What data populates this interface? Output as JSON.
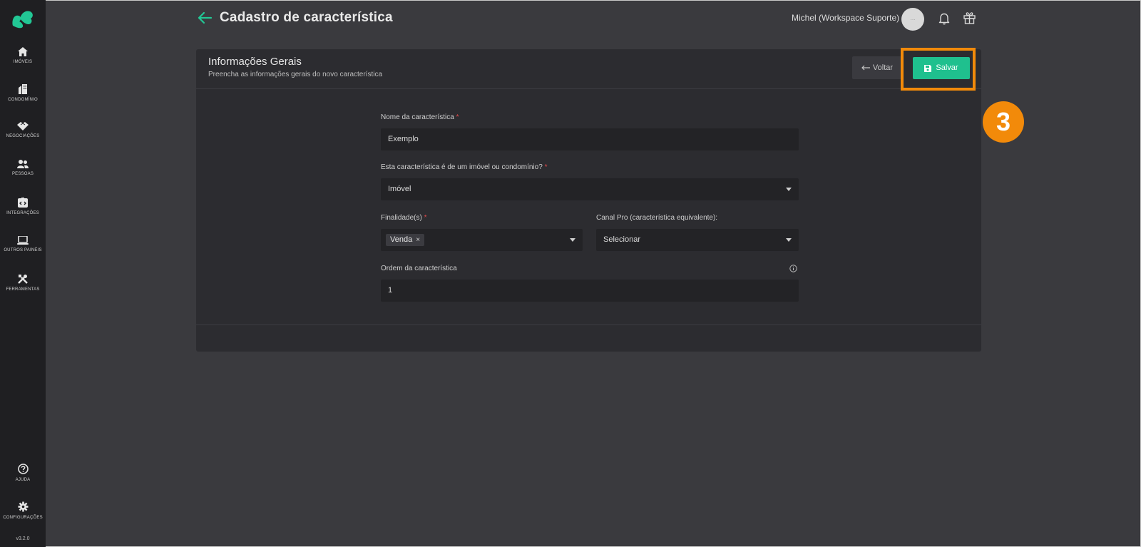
{
  "header": {
    "title": "Cadastro de característica",
    "user_name": "Michel (Workspace Suporte)",
    "avatar_text": "..."
  },
  "sidebar": {
    "items": [
      {
        "label": "IMÓVEIS",
        "icon": "home-icon"
      },
      {
        "label": "CONDOMÍNIO",
        "icon": "building-icon"
      },
      {
        "label": "NEGOCIAÇÕES",
        "icon": "handshake-icon"
      },
      {
        "label": "PESSOAS",
        "icon": "users-icon"
      },
      {
        "label": "INTEGRAÇÕES",
        "icon": "integration-icon"
      },
      {
        "label": "OUTROS PAINÉIS",
        "icon": "laptop-icon"
      },
      {
        "label": "FERRAMENTAS",
        "icon": "tools-icon"
      }
    ],
    "bottom_items": [
      {
        "label": "AJUDA",
        "icon": "help-icon"
      },
      {
        "label": "CONFIGURAÇÕES",
        "icon": "gear-icon"
      }
    ],
    "version": "v3.2.0"
  },
  "card": {
    "title": "Informações Gerais",
    "subtitle": "Preencha as informações gerais do novo característica",
    "back_label": "Voltar",
    "save_label": "Salvar"
  },
  "form": {
    "name": {
      "label": "Nome da característica",
      "required": "*",
      "value": "Exemplo"
    },
    "type": {
      "label": "Esta característica é de um imóvel ou condomínio?",
      "required": "*",
      "value": "Imóvel"
    },
    "purpose": {
      "label": "Finalidade(s)",
      "required": "*",
      "tags": [
        "Venda"
      ],
      "remove_glyph": "×"
    },
    "canal_pro": {
      "label": "Canal Pro (característica equivalente):",
      "value": "Selecionar"
    },
    "order": {
      "label": "Ordem da característica",
      "value": "1"
    }
  },
  "annotation": {
    "step": "3"
  },
  "colors": {
    "accent": "#1fc08e",
    "highlight": "#f28a0a",
    "sidebar": "#1f1f22",
    "background": "#3a3a3e",
    "card": "#2c2c30"
  }
}
